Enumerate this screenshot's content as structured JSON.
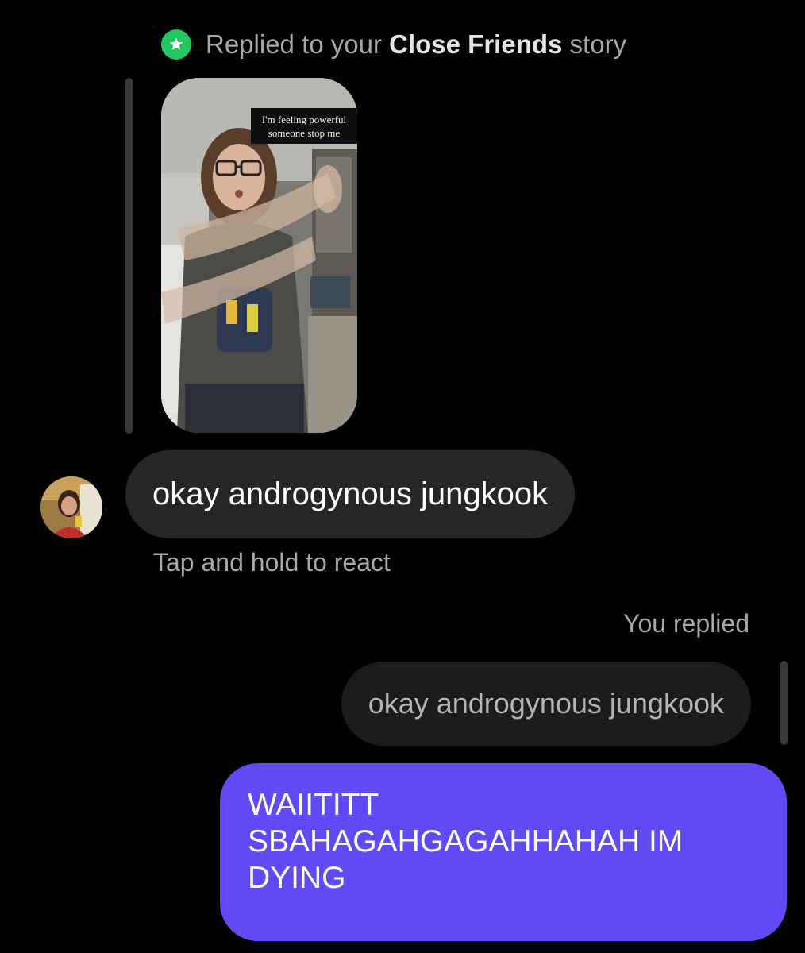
{
  "story_header": {
    "prefix": "Replied to your ",
    "list_name": "Close Friends",
    "suffix": " story",
    "badge_icon": "star-icon",
    "badge_color": "#22c55e"
  },
  "story": {
    "caption_line1": "I'm feeling powerful",
    "caption_line2": "someone stop me"
  },
  "received_message": {
    "avatar_icon": "user-avatar",
    "text": "okay androgynous jungkook",
    "hint": "Tap and hold to react"
  },
  "sent_reply": {
    "label": "You replied",
    "quoted_text": "okay androgynous jungkook",
    "text": "WAIITITT\nSBAHAGAHGAGAHHAHAH IM\nDYING",
    "bubble_color": "#6149f6"
  }
}
